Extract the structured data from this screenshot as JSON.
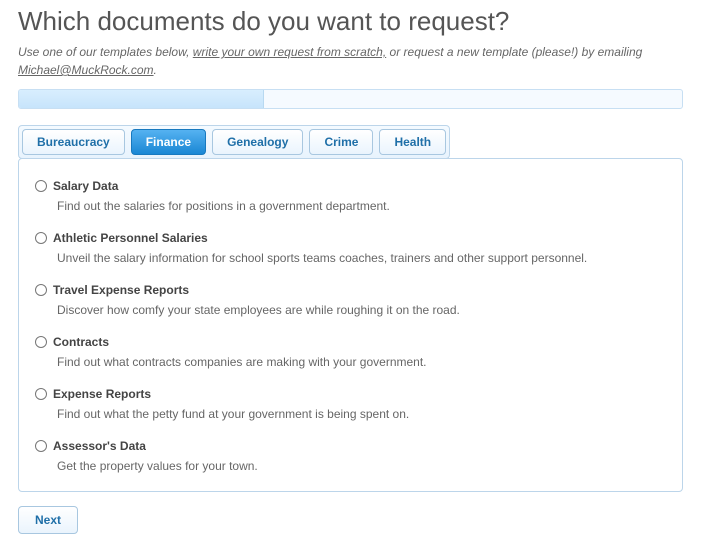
{
  "heading": "Which documents do you want to request?",
  "intro": {
    "part1": "Use one of our templates below, ",
    "link1": "write your own request from scratch,",
    "part2": " or request a new template (please!) by emailing ",
    "link2": "Michael@MuckRock.com",
    "part3": "."
  },
  "tabs": [
    "Bureaucracy",
    "Finance",
    "Genealogy",
    "Crime",
    "Health"
  ],
  "active_tab_index": 1,
  "options": [
    {
      "title": "Salary Data",
      "desc": "Find out the salaries for positions in a government department."
    },
    {
      "title": "Athletic Personnel Salaries",
      "desc": "Unveil the salary information for school sports teams coaches, trainers and other support personnel."
    },
    {
      "title": "Travel Expense Reports",
      "desc": "Discover how comfy your state employees are while roughing it on the road."
    },
    {
      "title": "Contracts",
      "desc": "Find out what contracts companies are making with your government."
    },
    {
      "title": "Expense Reports",
      "desc": "Find out what the petty fund at your government is being spent on."
    },
    {
      "title": "Assessor's Data",
      "desc": "Get the property values for your town."
    }
  ],
  "next_label": "Next"
}
